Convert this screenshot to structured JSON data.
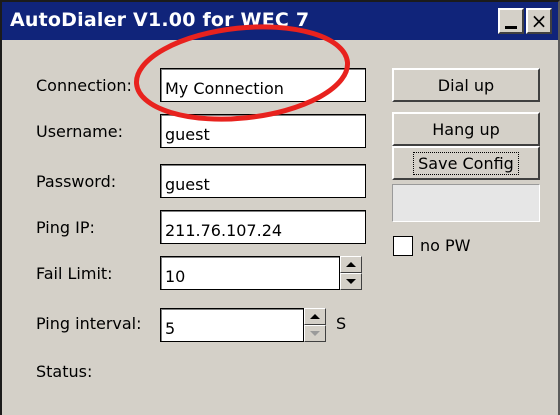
{
  "window": {
    "title": "AutoDialer V1.00 for WEC 7",
    "minimize_icon": "minimize-icon",
    "close_label": "×"
  },
  "form": {
    "connection_label": "Connection:",
    "connection_value": "My Connection",
    "username_label": "Username:",
    "username_value": "guest",
    "password_label": "Password:",
    "password_value": "guest",
    "ping_ip_label": "Ping IP:",
    "ping_ip_value": "211.76.107.24",
    "fail_limit_label": "Fail Limit:",
    "fail_limit_value": "10",
    "ping_interval_label": "Ping interval:",
    "ping_interval_value": "5",
    "ping_interval_unit": "S",
    "status_label": "Status:"
  },
  "buttons": {
    "dial_up": "Dial up",
    "hang_up": "Hang up",
    "save_config": "Save Config"
  },
  "options": {
    "no_pw_label": "no PW",
    "no_pw_checked": false
  },
  "colors": {
    "titlebar": "#10247a",
    "window_bg": "#d4d0c8",
    "annotation_ring": "#e8221e"
  }
}
